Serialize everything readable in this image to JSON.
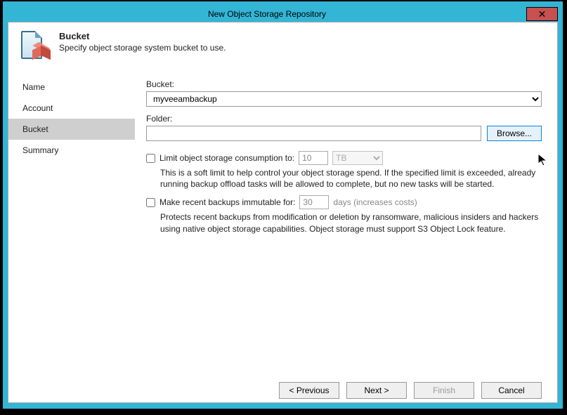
{
  "window": {
    "title": "New Object Storage Repository",
    "close_label": "✕"
  },
  "header": {
    "title": "Bucket",
    "subtitle": "Specify object storage system bucket to use."
  },
  "sidebar": {
    "items": [
      {
        "label": "Name"
      },
      {
        "label": "Account"
      },
      {
        "label": "Bucket"
      },
      {
        "label": "Summary"
      }
    ],
    "selected_index": 2
  },
  "content": {
    "bucket_label": "Bucket:",
    "bucket_value": "myveeambackup",
    "folder_label": "Folder:",
    "folder_value": "",
    "browse_label": "Browse...",
    "limit": {
      "checked": false,
      "label": "Limit object storage consumption to:",
      "value": "10",
      "unit": "TB",
      "desc": "This is a soft limit to help control your object storage spend. If the specified limit is exceeded, already running backup offload tasks will be allowed to complete, but no new tasks will be started."
    },
    "immutable": {
      "checked": false,
      "label": "Make recent backups immutable for:",
      "value": "30",
      "suffix": "days (increases costs)",
      "desc": "Protects recent backups from modification or deletion by ransomware, malicious insiders and hackers using native object storage capabilities. Object storage must support S3 Object Lock feature."
    }
  },
  "footer": {
    "previous": "< Previous",
    "next": "Next >",
    "finish": "Finish",
    "cancel": "Cancel"
  }
}
